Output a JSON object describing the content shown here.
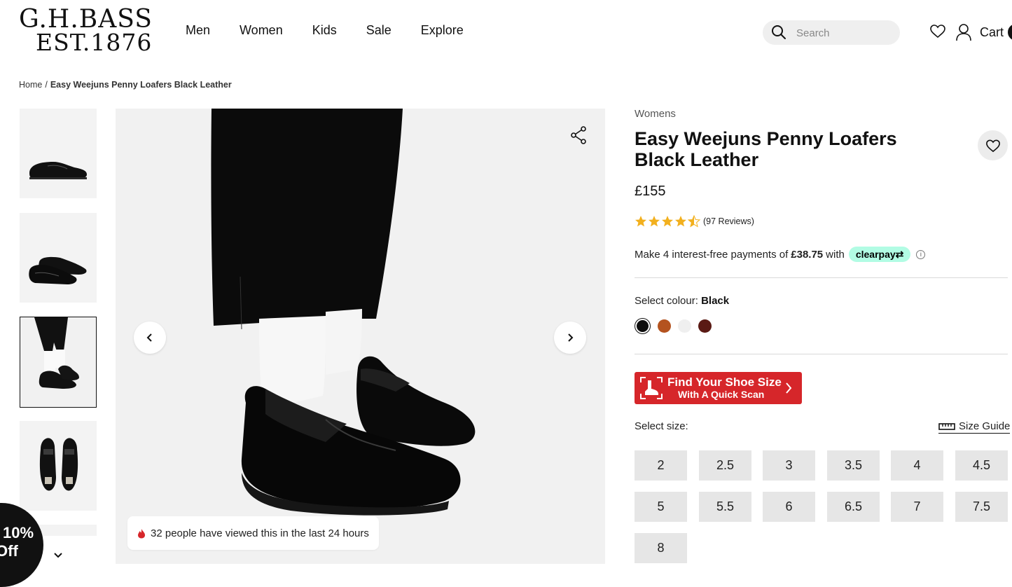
{
  "header": {
    "logo_line1": "G.H.BASS",
    "logo_line2": "EST.1876",
    "nav": [
      "Men",
      "Women",
      "Kids",
      "Sale",
      "Explore"
    ],
    "search_placeholder": "Search",
    "cart_label": "Cart"
  },
  "breadcrumb": {
    "home": "Home",
    "separator": "/",
    "current": "Easy Weejuns Penny Loafers Black Leather"
  },
  "gallery": {
    "selected_thumbnail_index": 2,
    "views_text": "32 people have viewed this in the last 24 hours"
  },
  "promo": {
    "line1": "10%",
    "line2": "Off"
  },
  "product": {
    "category": "Womens",
    "title": "Easy Weejuns Penny Loafers Black Leather",
    "price": "£155",
    "rating": 4.5,
    "reviews": "(97 Reviews)",
    "clearpay": {
      "prefix": "Make 4 interest-free payments of",
      "amount": "£38.75",
      "suffix": "with",
      "brand": "clearpay",
      "brand_color": "#b2fce4"
    },
    "colour": {
      "label": "Select colour:",
      "selected": "Black",
      "swatches": [
        "#0d0d0d",
        "#b4531f",
        "#efefef",
        "#5a1a14"
      ]
    },
    "scan": {
      "line1": "Find Your Shoe Size",
      "line2": "With A Quick Scan",
      "color": "#d6262a"
    },
    "size": {
      "label": "Select size:",
      "guide_label": "Size Guide",
      "options": [
        "2",
        "2.5",
        "3",
        "3.5",
        "4",
        "4.5",
        "5",
        "5.5",
        "6",
        "6.5",
        "7",
        "7.5",
        "8"
      ]
    }
  }
}
